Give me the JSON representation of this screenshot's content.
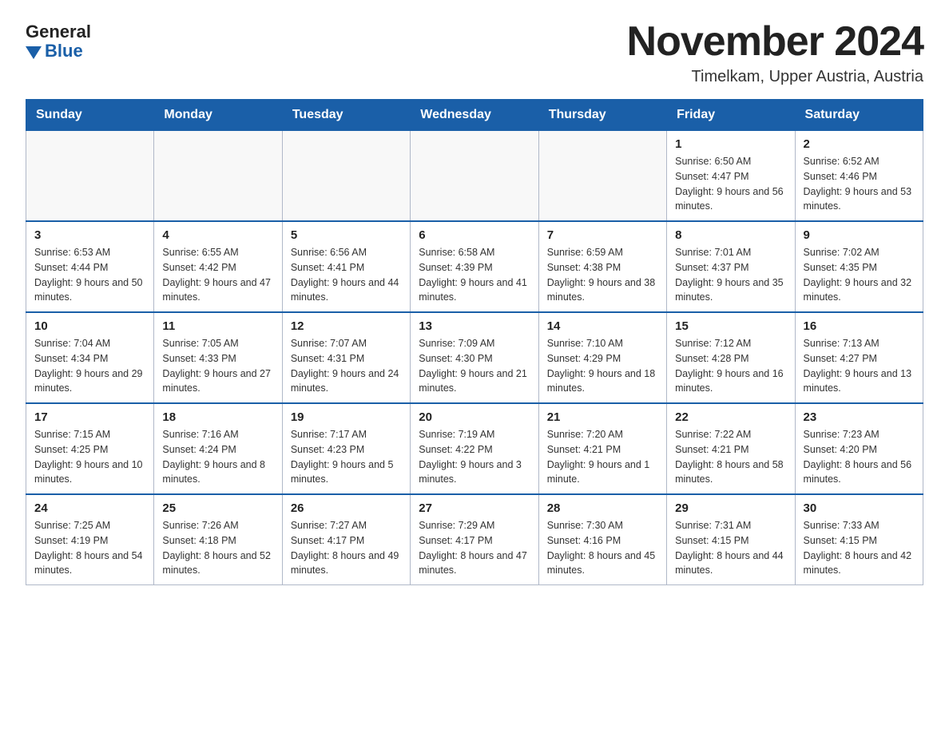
{
  "logo": {
    "general": "General",
    "blue": "Blue"
  },
  "title": "November 2024",
  "location": "Timelkam, Upper Austria, Austria",
  "weekdays": [
    "Sunday",
    "Monday",
    "Tuesday",
    "Wednesday",
    "Thursday",
    "Friday",
    "Saturday"
  ],
  "weeks": [
    [
      {
        "day": "",
        "info": ""
      },
      {
        "day": "",
        "info": ""
      },
      {
        "day": "",
        "info": ""
      },
      {
        "day": "",
        "info": ""
      },
      {
        "day": "",
        "info": ""
      },
      {
        "day": "1",
        "info": "Sunrise: 6:50 AM\nSunset: 4:47 PM\nDaylight: 9 hours and 56 minutes."
      },
      {
        "day": "2",
        "info": "Sunrise: 6:52 AM\nSunset: 4:46 PM\nDaylight: 9 hours and 53 minutes."
      }
    ],
    [
      {
        "day": "3",
        "info": "Sunrise: 6:53 AM\nSunset: 4:44 PM\nDaylight: 9 hours and 50 minutes."
      },
      {
        "day": "4",
        "info": "Sunrise: 6:55 AM\nSunset: 4:42 PM\nDaylight: 9 hours and 47 minutes."
      },
      {
        "day": "5",
        "info": "Sunrise: 6:56 AM\nSunset: 4:41 PM\nDaylight: 9 hours and 44 minutes."
      },
      {
        "day": "6",
        "info": "Sunrise: 6:58 AM\nSunset: 4:39 PM\nDaylight: 9 hours and 41 minutes."
      },
      {
        "day": "7",
        "info": "Sunrise: 6:59 AM\nSunset: 4:38 PM\nDaylight: 9 hours and 38 minutes."
      },
      {
        "day": "8",
        "info": "Sunrise: 7:01 AM\nSunset: 4:37 PM\nDaylight: 9 hours and 35 minutes."
      },
      {
        "day": "9",
        "info": "Sunrise: 7:02 AM\nSunset: 4:35 PM\nDaylight: 9 hours and 32 minutes."
      }
    ],
    [
      {
        "day": "10",
        "info": "Sunrise: 7:04 AM\nSunset: 4:34 PM\nDaylight: 9 hours and 29 minutes."
      },
      {
        "day": "11",
        "info": "Sunrise: 7:05 AM\nSunset: 4:33 PM\nDaylight: 9 hours and 27 minutes."
      },
      {
        "day": "12",
        "info": "Sunrise: 7:07 AM\nSunset: 4:31 PM\nDaylight: 9 hours and 24 minutes."
      },
      {
        "day": "13",
        "info": "Sunrise: 7:09 AM\nSunset: 4:30 PM\nDaylight: 9 hours and 21 minutes."
      },
      {
        "day": "14",
        "info": "Sunrise: 7:10 AM\nSunset: 4:29 PM\nDaylight: 9 hours and 18 minutes."
      },
      {
        "day": "15",
        "info": "Sunrise: 7:12 AM\nSunset: 4:28 PM\nDaylight: 9 hours and 16 minutes."
      },
      {
        "day": "16",
        "info": "Sunrise: 7:13 AM\nSunset: 4:27 PM\nDaylight: 9 hours and 13 minutes."
      }
    ],
    [
      {
        "day": "17",
        "info": "Sunrise: 7:15 AM\nSunset: 4:25 PM\nDaylight: 9 hours and 10 minutes."
      },
      {
        "day": "18",
        "info": "Sunrise: 7:16 AM\nSunset: 4:24 PM\nDaylight: 9 hours and 8 minutes."
      },
      {
        "day": "19",
        "info": "Sunrise: 7:17 AM\nSunset: 4:23 PM\nDaylight: 9 hours and 5 minutes."
      },
      {
        "day": "20",
        "info": "Sunrise: 7:19 AM\nSunset: 4:22 PM\nDaylight: 9 hours and 3 minutes."
      },
      {
        "day": "21",
        "info": "Sunrise: 7:20 AM\nSunset: 4:21 PM\nDaylight: 9 hours and 1 minute."
      },
      {
        "day": "22",
        "info": "Sunrise: 7:22 AM\nSunset: 4:21 PM\nDaylight: 8 hours and 58 minutes."
      },
      {
        "day": "23",
        "info": "Sunrise: 7:23 AM\nSunset: 4:20 PM\nDaylight: 8 hours and 56 minutes."
      }
    ],
    [
      {
        "day": "24",
        "info": "Sunrise: 7:25 AM\nSunset: 4:19 PM\nDaylight: 8 hours and 54 minutes."
      },
      {
        "day": "25",
        "info": "Sunrise: 7:26 AM\nSunset: 4:18 PM\nDaylight: 8 hours and 52 minutes."
      },
      {
        "day": "26",
        "info": "Sunrise: 7:27 AM\nSunset: 4:17 PM\nDaylight: 8 hours and 49 minutes."
      },
      {
        "day": "27",
        "info": "Sunrise: 7:29 AM\nSunset: 4:17 PM\nDaylight: 8 hours and 47 minutes."
      },
      {
        "day": "28",
        "info": "Sunrise: 7:30 AM\nSunset: 4:16 PM\nDaylight: 8 hours and 45 minutes."
      },
      {
        "day": "29",
        "info": "Sunrise: 7:31 AM\nSunset: 4:15 PM\nDaylight: 8 hours and 44 minutes."
      },
      {
        "day": "30",
        "info": "Sunrise: 7:33 AM\nSunset: 4:15 PM\nDaylight: 8 hours and 42 minutes."
      }
    ]
  ]
}
